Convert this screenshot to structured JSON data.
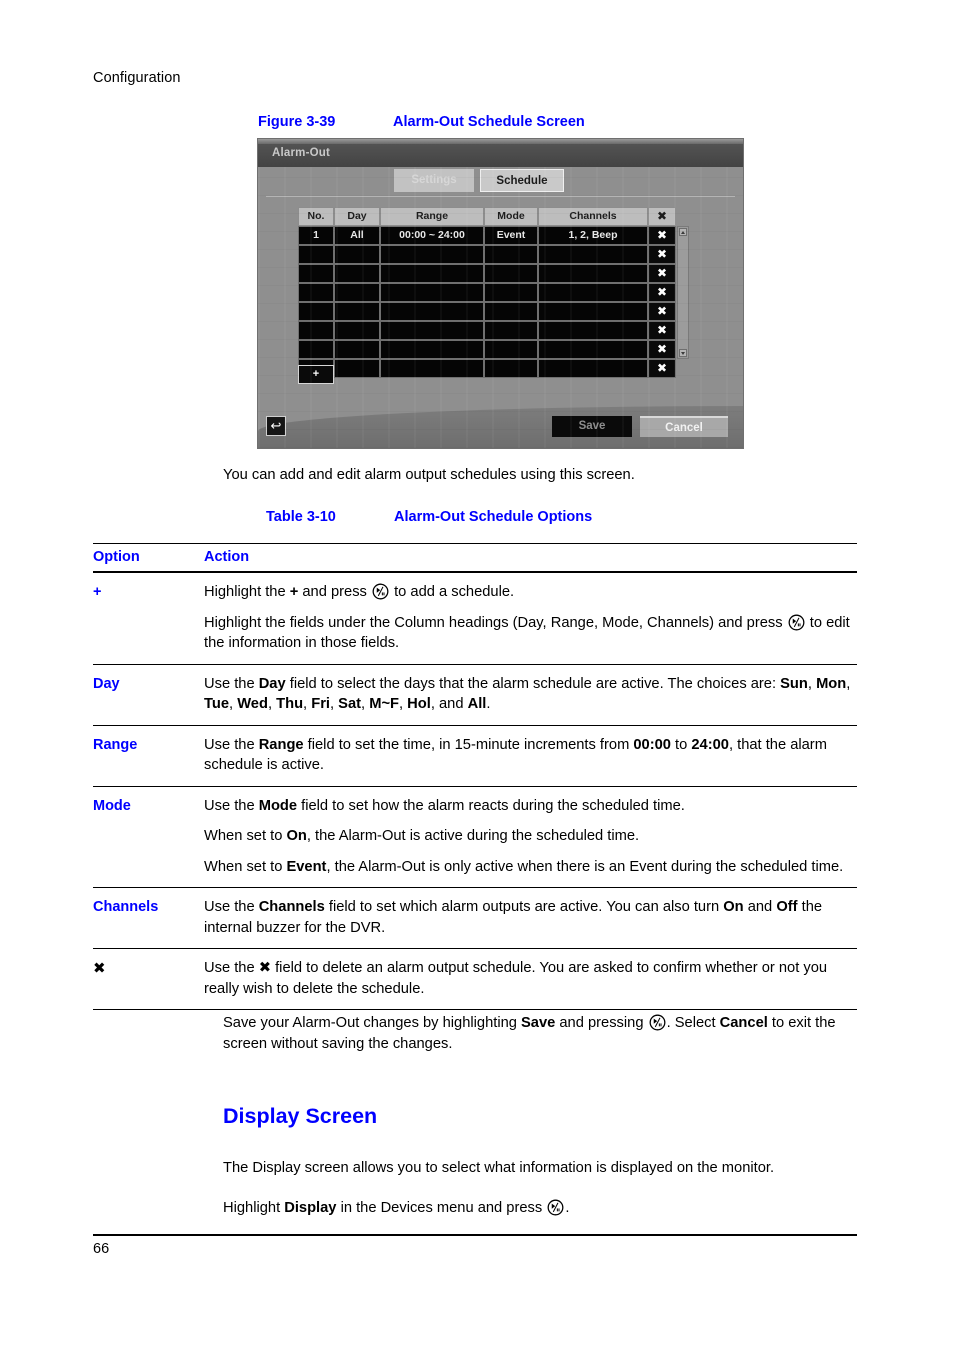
{
  "header": {
    "running_head": "Configuration"
  },
  "figure": {
    "number": "Figure 3-39",
    "title": "Alarm-Out Schedule Screen"
  },
  "dvr": {
    "window_title": "Alarm-Out",
    "tabs": [
      {
        "label": "Settings",
        "active": false
      },
      {
        "label": "Schedule",
        "active": true
      }
    ],
    "columns": [
      "No.",
      "Day",
      "Range",
      "Mode",
      "Channels",
      "✖"
    ],
    "rows": [
      {
        "no": "1",
        "day": "All",
        "range": "00:00 ~ 24:00",
        "mode": "Event",
        "channels": "1, 2, Beep",
        "delete": "✖"
      },
      {
        "no": "",
        "day": "",
        "range": "",
        "mode": "",
        "channels": "",
        "delete": "✖"
      },
      {
        "no": "",
        "day": "",
        "range": "",
        "mode": "",
        "channels": "",
        "delete": "✖"
      },
      {
        "no": "",
        "day": "",
        "range": "",
        "mode": "",
        "channels": "",
        "delete": "✖"
      },
      {
        "no": "",
        "day": "",
        "range": "",
        "mode": "",
        "channels": "",
        "delete": "✖"
      },
      {
        "no": "",
        "day": "",
        "range": "",
        "mode": "",
        "channels": "",
        "delete": "✖"
      },
      {
        "no": "",
        "day": "",
        "range": "",
        "mode": "",
        "channels": "",
        "delete": "✖"
      },
      {
        "no": "",
        "day": "",
        "range": "",
        "mode": "",
        "channels": "",
        "delete": "✖"
      }
    ],
    "add_button_label": "+",
    "back_button_label": "↩",
    "save_label": "Save",
    "cancel_label": "Cancel"
  },
  "intro_paragraph": "You can add and edit alarm output schedules using this screen.",
  "table": {
    "number": "Table 3-10",
    "title": "Alarm-Out Schedule Options",
    "headers": {
      "option": "Option",
      "action": "Action"
    },
    "rows": [
      {
        "option": "+",
        "option_color": "#0000ff",
        "paragraphs": [
          "Highlight the + and press (play/pause) to add a schedule.",
          "Highlight the fields under the Column headings (Day, Range, Mode, Channels) and press (play/pause) to edit the information in those fields."
        ]
      },
      {
        "option": "Day",
        "option_color": "#0000ff",
        "paragraphs": [
          "Use the Day field to select the days that the alarm schedule are active. The choices are: Sun, Mon, Tue, Wed, Thu, Fri, Sat, M~F, Hol, and All."
        ]
      },
      {
        "option": "Range",
        "option_color": "#0000ff",
        "paragraphs": [
          "Use the Range field to set the time, in 15-minute increments from 00:00 to 24:00, that the alarm schedule is active."
        ]
      },
      {
        "option": "Mode",
        "option_color": "#0000ff",
        "paragraphs": [
          "Use the Mode field to set how the alarm reacts during the scheduled time.",
          "When set to On, the Alarm-Out is active during the scheduled time.",
          "When set to Event, the Alarm-Out is only active when there is an Event during the scheduled time."
        ]
      },
      {
        "option": "Channels",
        "option_color": "#0000ff",
        "paragraphs": [
          "Use the Channels field to set which alarm outputs are active. You can also turn On and Off the internal buzzer for the DVR."
        ]
      },
      {
        "option": "✖",
        "option_color": "#000000",
        "paragraphs": [
          "Use the ✖ field to delete an alarm output schedule. You are asked to confirm whether or not you really wish to delete the schedule."
        ]
      }
    ]
  },
  "save_paragraph": "Save your Alarm-Out changes by highlighting Save and pressing (play/pause). Select Cancel to exit the screen without saving the changes.",
  "display_section": {
    "heading": "Display Screen",
    "paragraph_1": "The Display screen allows you to select what information is displayed on the monitor.",
    "paragraph_2": "Highlight Display in the Devices menu and press (play/pause)."
  },
  "footer": {
    "page_number": "66"
  },
  "colors": {
    "accent_blue": "#0000ff",
    "body_text": "#000000"
  }
}
